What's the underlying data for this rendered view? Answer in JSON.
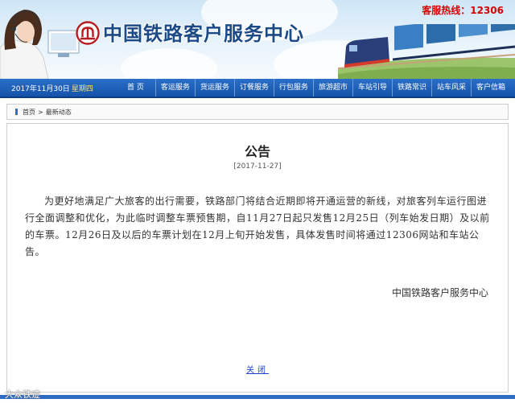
{
  "header": {
    "site_title": "中国铁路客户服务中心",
    "hotline": "客服热线：12306",
    "colors": {
      "title": "#1c4a87",
      "hotline": "#d80000"
    }
  },
  "nav": {
    "date": "2017年11月30日",
    "weekday": "星期四",
    "items": [
      "首 页",
      "客运服务",
      "货运服务",
      "订餐服务",
      "行包服务",
      "旅游超市",
      "车站引导",
      "铁路常识",
      "站车风采",
      "客户信箱"
    ],
    "colors": {
      "bar": "#1553a8",
      "weekday": "#ffe270"
    }
  },
  "breadcrumb": {
    "home": "首页",
    "separator": ">",
    "current": "最新动态"
  },
  "announcement": {
    "title": "公告",
    "date": "[2017-11-27]",
    "body": "为更好地满足广大旅客的出行需要，铁路部门将结合近期即将开通运营的新线，对旅客列车运行图进行全面调整和优化，为此临时调整车票预售期，自11月27日起只发售12月25日（列车始发日期）及以前的车票。12月26日及以后的车票计划在12月上旬开始发售，具体发售时间将通过12306网站和车站公告。",
    "signature": "中国铁路客户服务中心",
    "close_label": "关闭"
  },
  "watermark": "大众铁迹",
  "icons": {
    "logo": "railway-logo-icon",
    "agent": "customer-service-agent-icon",
    "train": "freight-train-icon",
    "breadcrumb_marker": "breadcrumb-marker-icon"
  }
}
